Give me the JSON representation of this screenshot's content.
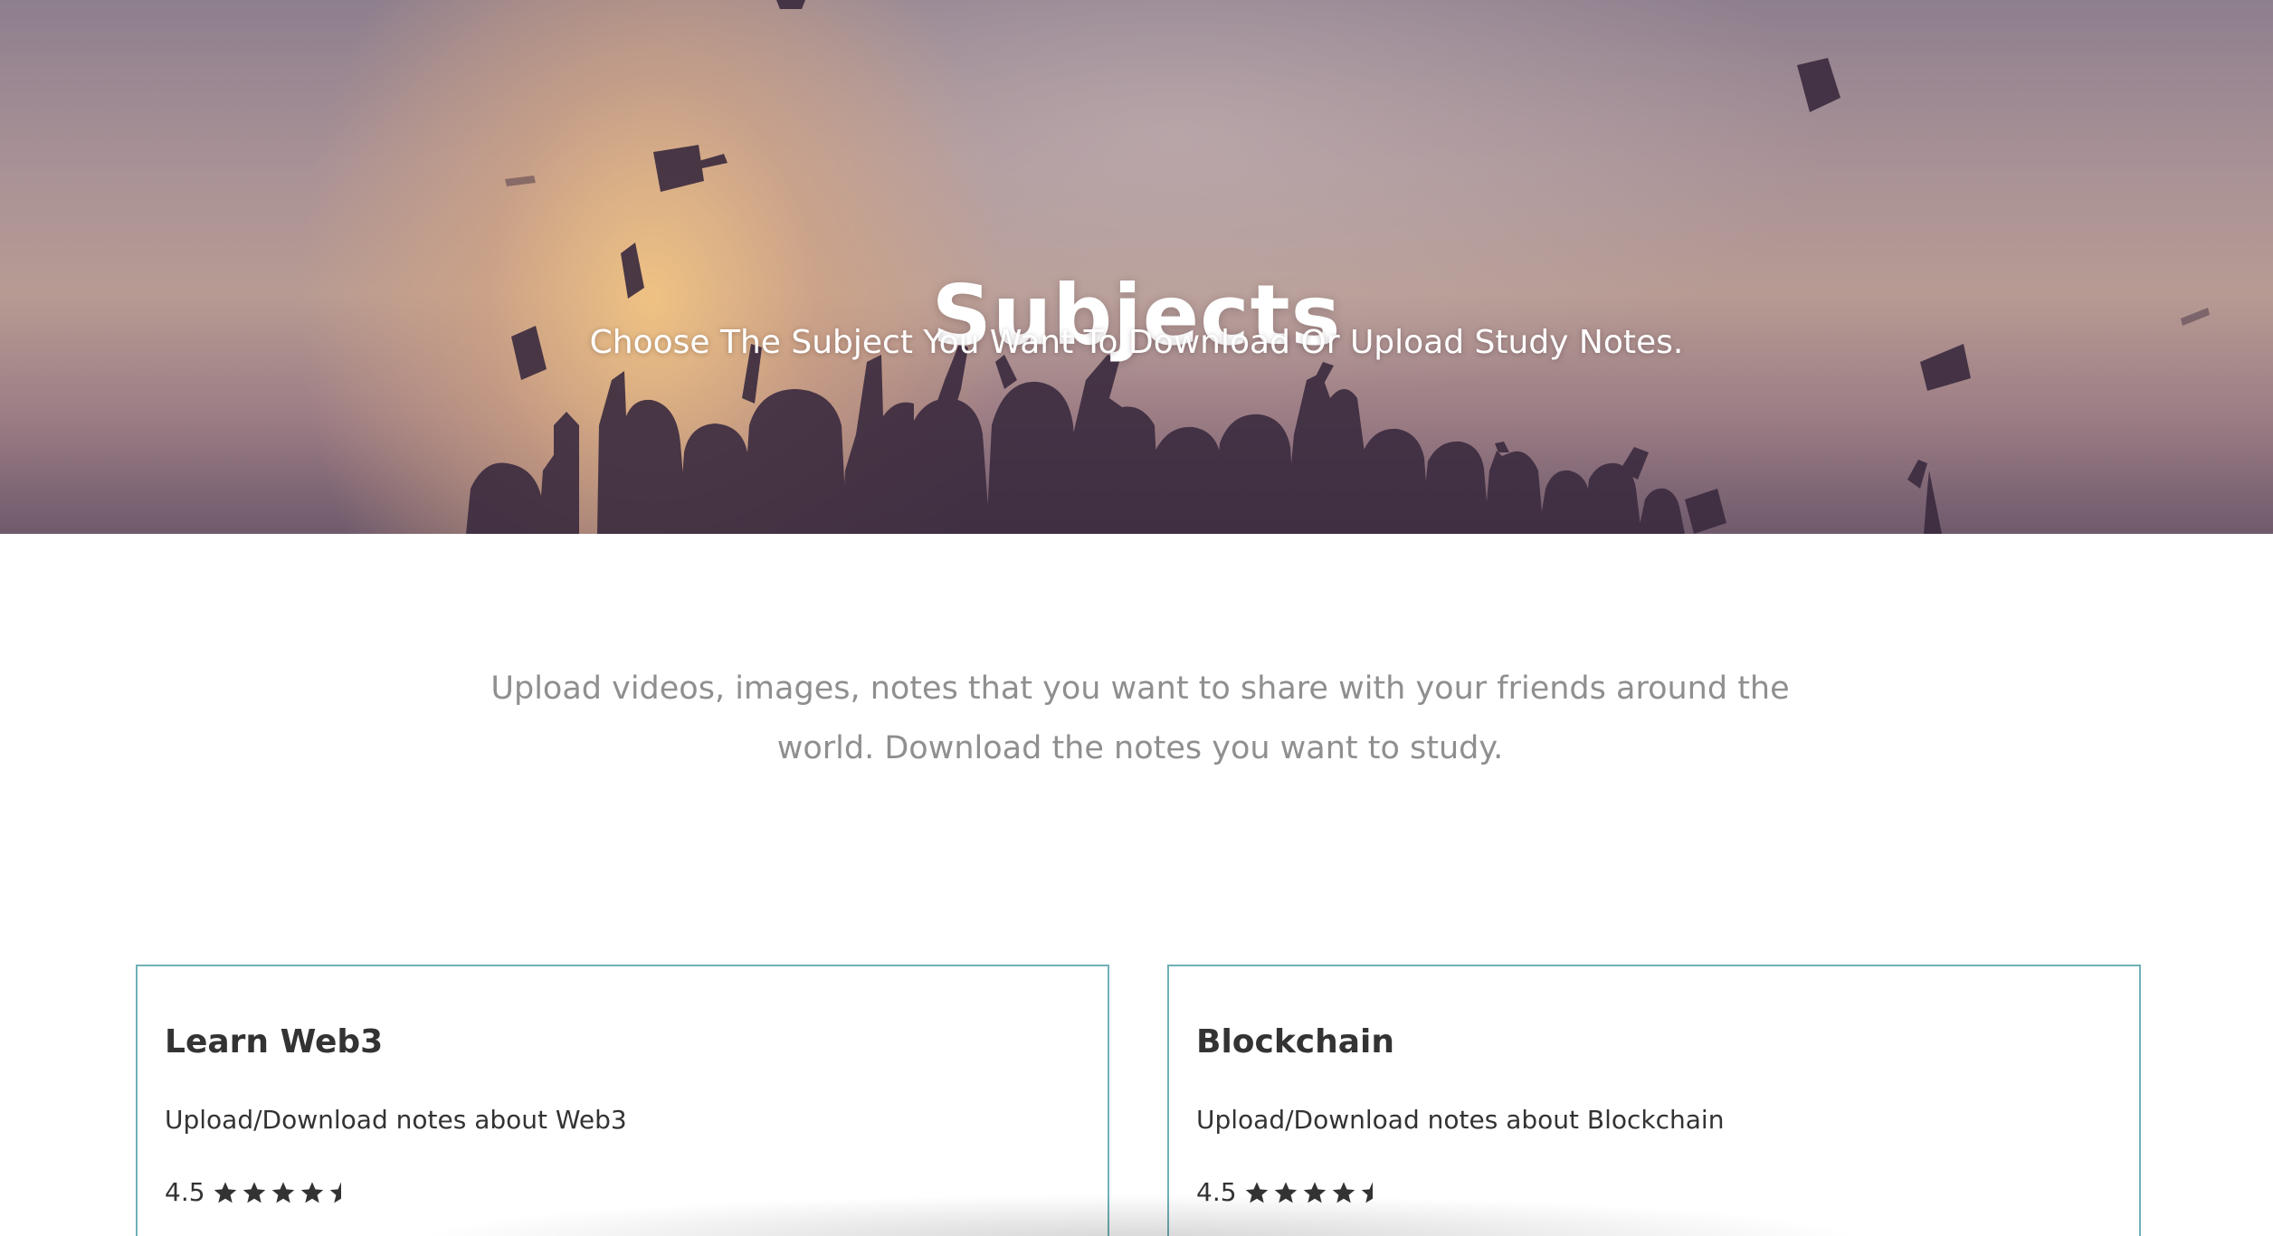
{
  "hero": {
    "title": "Subjects",
    "subtitle": "Choose The Subject You Want To Download Or Upload Study Notes."
  },
  "intro": {
    "line1": "Upload videos, images, notes that you want to share with your friends around the",
    "line2": "world. Download the notes you want to study."
  },
  "cards": [
    {
      "title": "Learn Web3",
      "description": "Upload/Download notes about Web3",
      "rating": "4.5",
      "stars": 4.5
    },
    {
      "title": "Blockchain",
      "description": "Upload/Download notes about Blockchain",
      "rating": "4.5",
      "stars": 4.5
    }
  ],
  "colors": {
    "card_border": "#6fb0b6",
    "intro_text": "#8f8f8f",
    "dark_text": "#333333"
  }
}
